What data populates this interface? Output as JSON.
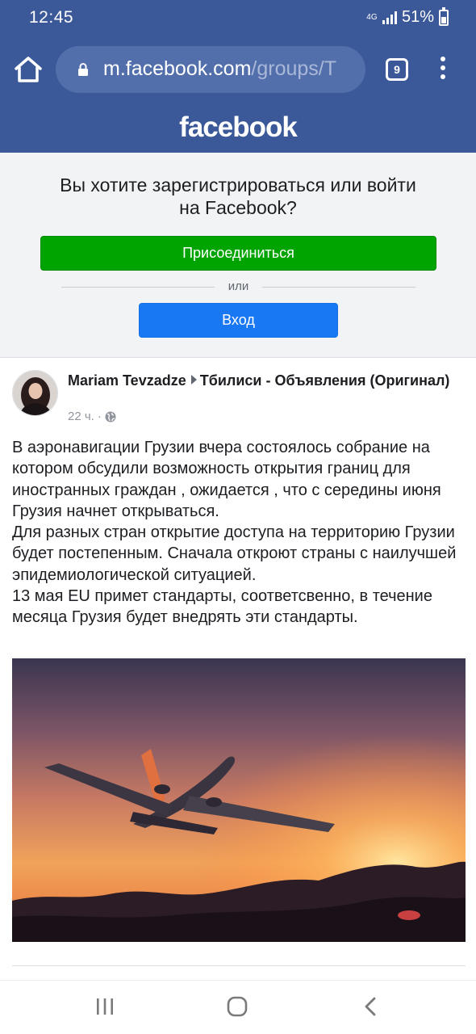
{
  "status_bar": {
    "time": "12:45",
    "network": "4G",
    "battery": "51%"
  },
  "browser": {
    "url_domain": "m.facebook.com",
    "url_path": "/groups/T",
    "tab_count": "9"
  },
  "header": {
    "logo": "facebook",
    "brand_color": "#3b5998"
  },
  "register": {
    "prompt": "Вы хотите зарегистрироваться или войти на Facebook?",
    "join_label": "Присоединиться",
    "or_label": "или",
    "login_label": "Вход",
    "join_color": "#00a400",
    "login_color": "#1877f2"
  },
  "post": {
    "author": "Mariam Tevzadze",
    "group": "Тбилиси - Объявления (Оригинал)",
    "time": "22 ч.",
    "separator": "·",
    "paragraphs": [
      "В аэронавигации Грузии вчера состоялось собрание на котором обсудили возможность открытия границ для иностранных граждан , ожидается , что с середины июня Грузия начнет открываться.",
      "Для разных стран открытие доступа на территорию Грузии будет постепенным. Сначала откроют страны с наилучшей эпидемиологической ситуацией.",
      "13 мая EU примет стандарты, соответсвенно, в течение месяца Грузия будет внедрять эти стандарты."
    ]
  },
  "icons": {
    "home": "home-icon",
    "lock": "lock-icon",
    "tabs": "tabs-icon",
    "menu": "more-vert-icon",
    "globe": "globe-icon",
    "recent": "recent-apps-icon",
    "nav_home": "nav-home-icon",
    "back": "back-icon"
  }
}
